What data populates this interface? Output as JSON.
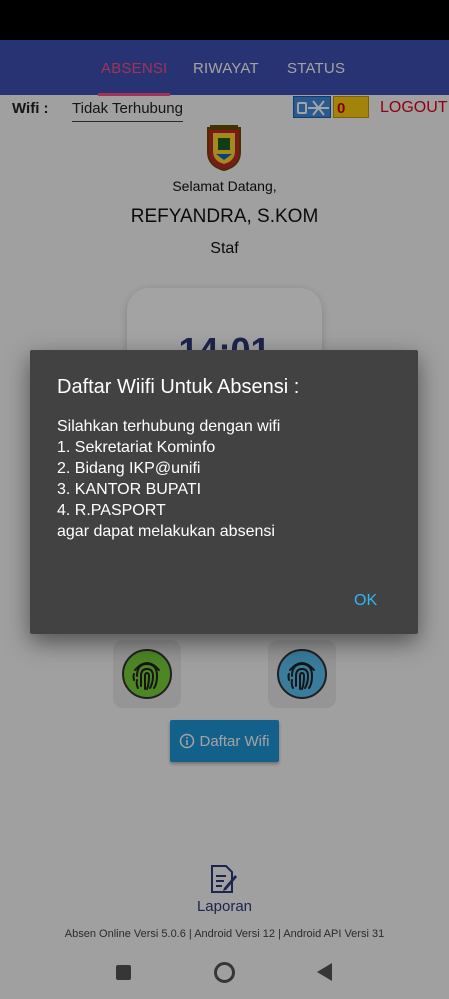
{
  "tabs": [
    {
      "label": "ABSENSI",
      "active": true
    },
    {
      "label": "RIWAYAT",
      "active": false
    },
    {
      "label": "STATUS",
      "active": false
    }
  ],
  "wifi": {
    "label": "Wifi :",
    "status": "Tidak Terhubung",
    "counter": "0"
  },
  "logout_label": "LOGOUT",
  "welcome": {
    "greeting": "Selamat Datang,",
    "name": "REFYANDRA, S.KOM",
    "role": "Staf"
  },
  "clock": "14:01",
  "buttons": {
    "daftar_wifi": "Daftar Wifi"
  },
  "laporan_label": "Laporan",
  "version_text": "Absen Online Versi 5.0.6 | Android Versi 12 | Android API Versi 31",
  "dialog": {
    "title": "Daftar Wiifi Untuk Absensi :",
    "lines": [
      "Silahkan terhubung dengan wifi",
      "1. Sekretariat Kominfo",
      "2. Bidang IKP@unifi",
      "3. KANTOR BUPATI",
      "4. R.PASPORT",
      "agar dapat melakukan absensi"
    ],
    "ok_label": "OK"
  },
  "colors": {
    "primary": "#3f51b5",
    "accent": "#ff4f8b",
    "button_blue": "#1e97d8",
    "logout_red": "#e0001a",
    "dialog_bg": "#424242",
    "ok_blue": "#33b5f5",
    "finger_green": "#7bd23a",
    "finger_blue": "#5cc3f4"
  },
  "icons": {
    "wifi_status": "wifi-off-icon",
    "fingerprint_in": "fingerprint-icon",
    "fingerprint_out": "fingerprint-icon",
    "info": "info-icon",
    "laporan": "document-edit-icon",
    "nav_recent": "recent-apps-icon",
    "nav_home": "home-icon",
    "nav_back": "back-icon"
  }
}
